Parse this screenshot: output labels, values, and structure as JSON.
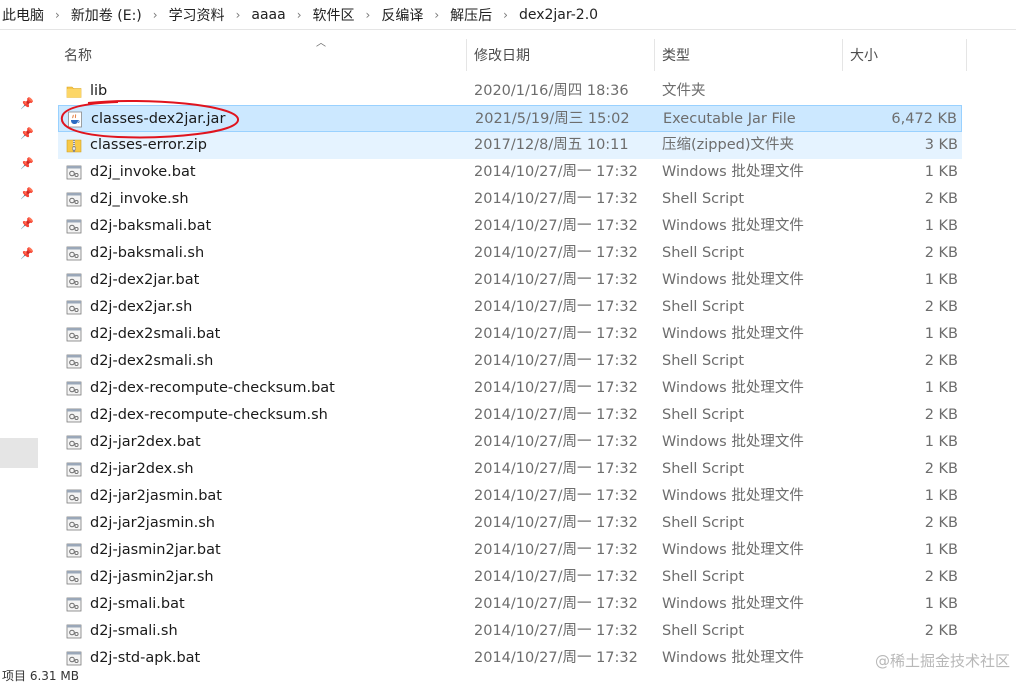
{
  "breadcrumb": {
    "items": [
      "此电脑",
      "新加卷 (E:)",
      "学习资料",
      "aaaa",
      "软件区",
      "反编译",
      "解压后",
      "dex2jar-2.0"
    ],
    "separator": "›"
  },
  "columns": {
    "name": "名称",
    "date": "修改日期",
    "type": "类型",
    "size": "大小"
  },
  "files": [
    {
      "name": "lib",
      "date": "2020/1/16/周四 18:36",
      "type": "文件夹",
      "size": "",
      "icon": "folder-icon",
      "state": ""
    },
    {
      "name": "classes-dex2jar.jar",
      "date": "2021/5/19/周三 15:02",
      "type": "Executable Jar File",
      "size": "6,472 KB",
      "icon": "jar-icon",
      "state": "selected"
    },
    {
      "name": "classes-error.zip",
      "date": "2017/12/8/周五 10:11",
      "type": "压缩(zipped)文件夹",
      "size": "3 KB",
      "icon": "zip-icon",
      "state": "hover"
    },
    {
      "name": "d2j_invoke.bat",
      "date": "2014/10/27/周一 17:32",
      "type": "Windows 批处理文件",
      "size": "1 KB",
      "icon": "script-icon",
      "state": ""
    },
    {
      "name": "d2j_invoke.sh",
      "date": "2014/10/27/周一 17:32",
      "type": "Shell Script",
      "size": "2 KB",
      "icon": "script-icon",
      "state": ""
    },
    {
      "name": "d2j-baksmali.bat",
      "date": "2014/10/27/周一 17:32",
      "type": "Windows 批处理文件",
      "size": "1 KB",
      "icon": "script-icon",
      "state": ""
    },
    {
      "name": "d2j-baksmali.sh",
      "date": "2014/10/27/周一 17:32",
      "type": "Shell Script",
      "size": "2 KB",
      "icon": "script-icon",
      "state": ""
    },
    {
      "name": "d2j-dex2jar.bat",
      "date": "2014/10/27/周一 17:32",
      "type": "Windows 批处理文件",
      "size": "1 KB",
      "icon": "script-icon",
      "state": ""
    },
    {
      "name": "d2j-dex2jar.sh",
      "date": "2014/10/27/周一 17:32",
      "type": "Shell Script",
      "size": "2 KB",
      "icon": "script-icon",
      "state": ""
    },
    {
      "name": "d2j-dex2smali.bat",
      "date": "2014/10/27/周一 17:32",
      "type": "Windows 批处理文件",
      "size": "1 KB",
      "icon": "script-icon",
      "state": ""
    },
    {
      "name": "d2j-dex2smali.sh",
      "date": "2014/10/27/周一 17:32",
      "type": "Shell Script",
      "size": "2 KB",
      "icon": "script-icon",
      "state": ""
    },
    {
      "name": "d2j-dex-recompute-checksum.bat",
      "date": "2014/10/27/周一 17:32",
      "type": "Windows 批处理文件",
      "size": "1 KB",
      "icon": "script-icon",
      "state": ""
    },
    {
      "name": "d2j-dex-recompute-checksum.sh",
      "date": "2014/10/27/周一 17:32",
      "type": "Shell Script",
      "size": "2 KB",
      "icon": "script-icon",
      "state": ""
    },
    {
      "name": "d2j-jar2dex.bat",
      "date": "2014/10/27/周一 17:32",
      "type": "Windows 批处理文件",
      "size": "1 KB",
      "icon": "script-icon",
      "state": ""
    },
    {
      "name": "d2j-jar2dex.sh",
      "date": "2014/10/27/周一 17:32",
      "type": "Shell Script",
      "size": "2 KB",
      "icon": "script-icon",
      "state": ""
    },
    {
      "name": "d2j-jar2jasmin.bat",
      "date": "2014/10/27/周一 17:32",
      "type": "Windows 批处理文件",
      "size": "1 KB",
      "icon": "script-icon",
      "state": ""
    },
    {
      "name": "d2j-jar2jasmin.sh",
      "date": "2014/10/27/周一 17:32",
      "type": "Shell Script",
      "size": "2 KB",
      "icon": "script-icon",
      "state": ""
    },
    {
      "name": "d2j-jasmin2jar.bat",
      "date": "2014/10/27/周一 17:32",
      "type": "Windows 批处理文件",
      "size": "1 KB",
      "icon": "script-icon",
      "state": ""
    },
    {
      "name": "d2j-jasmin2jar.sh",
      "date": "2014/10/27/周一 17:32",
      "type": "Shell Script",
      "size": "2 KB",
      "icon": "script-icon",
      "state": ""
    },
    {
      "name": "d2j-smali.bat",
      "date": "2014/10/27/周一 17:32",
      "type": "Windows 批处理文件",
      "size": "1 KB",
      "icon": "script-icon",
      "state": ""
    },
    {
      "name": "d2j-smali.sh",
      "date": "2014/10/27/周一 17:32",
      "type": "Shell Script",
      "size": "2 KB",
      "icon": "script-icon",
      "state": ""
    },
    {
      "name": "d2j-std-apk.bat",
      "date": "2014/10/27/周一 17:32",
      "type": "Windows 批处理文件",
      "size": "",
      "icon": "script-icon",
      "state": ""
    }
  ],
  "status_bar": {
    "text": "项目  6.31 MB"
  },
  "watermark": "@稀土掘金技术社区",
  "colors": {
    "selected_bg": "#cce8ff",
    "selected_border": "#99d1ff",
    "hover_bg": "#e5f3ff",
    "annotation": "#e0141e"
  }
}
